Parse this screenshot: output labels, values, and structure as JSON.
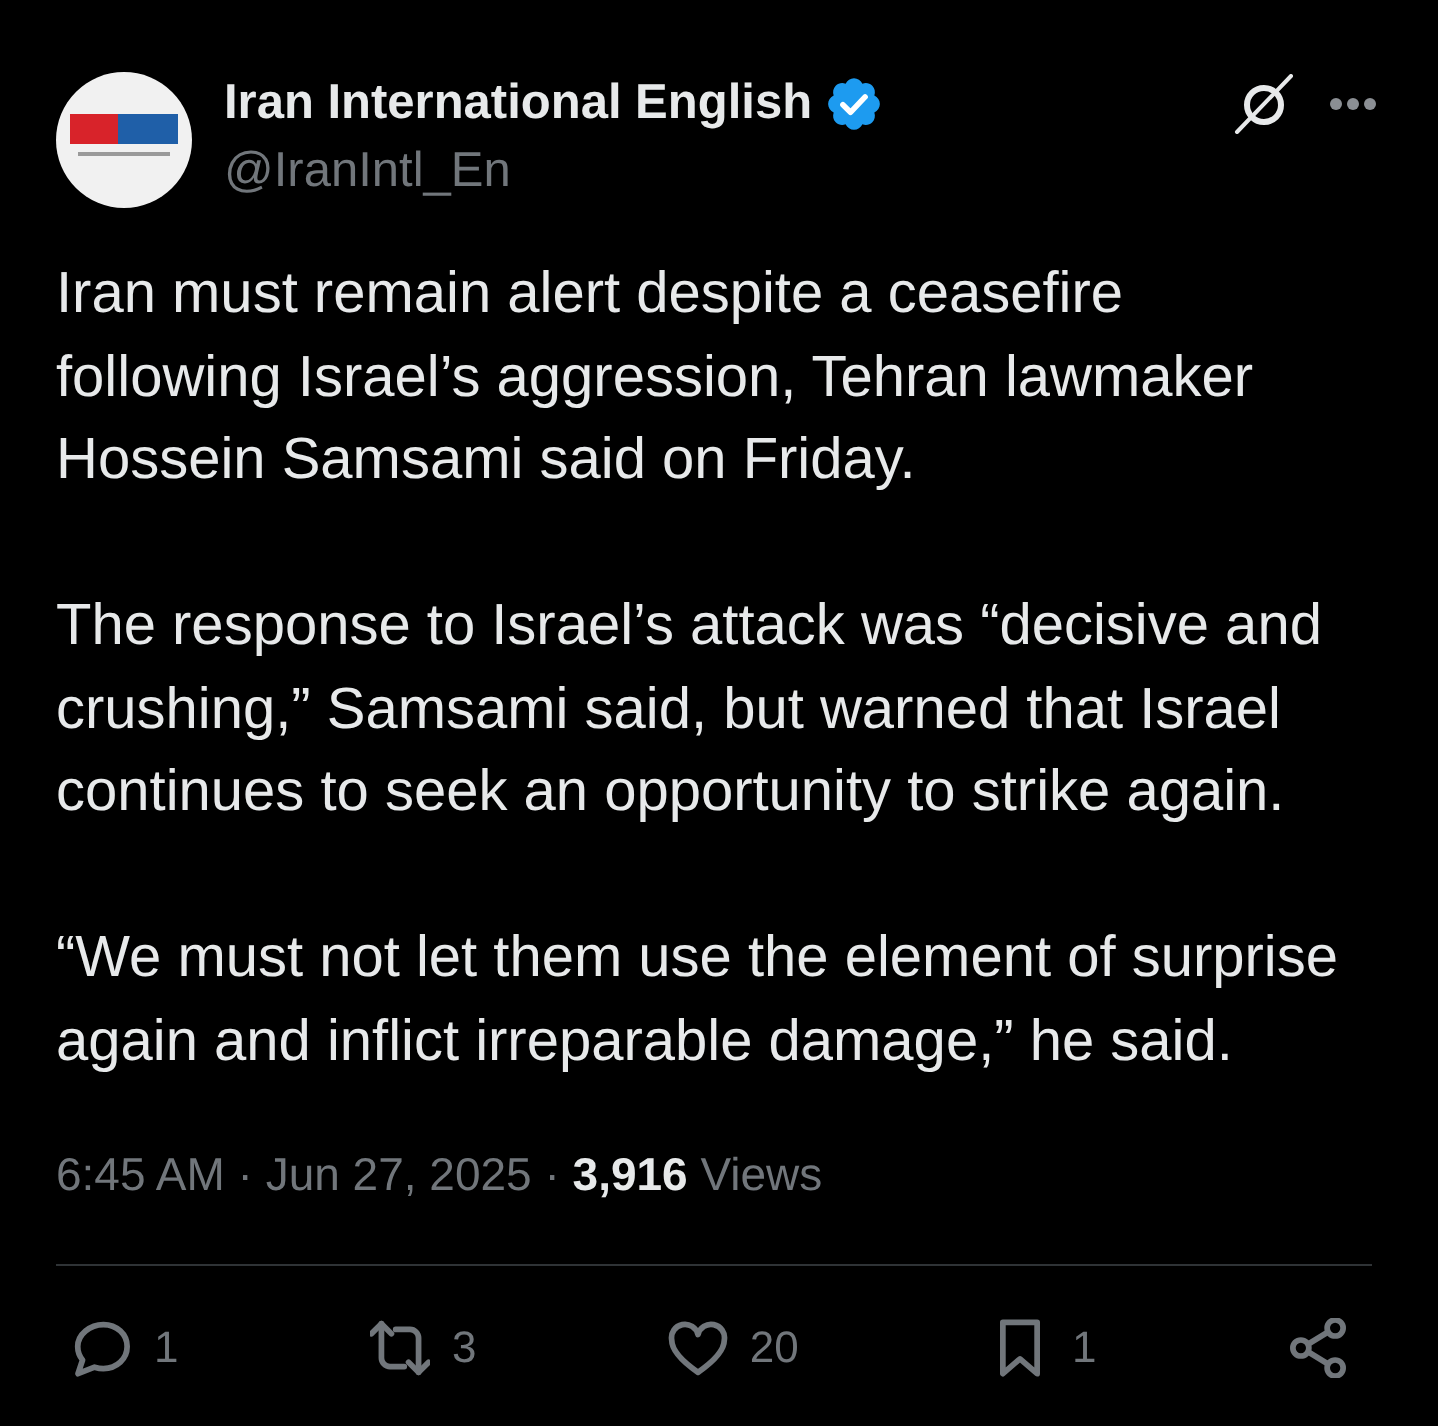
{
  "author": {
    "name": "Iran International English",
    "verified": true,
    "handle": "@IranIntl_En"
  },
  "post": {
    "paragraphs": [
      "Iran must remain alert despite a ceasefire following Israel’s aggression, Tehran lawmaker Hossein Samsami said on Friday.",
      "The response to Israel’s attack was “decisive and crushing,” Samsami said, but warned that Israel continues to seek an opportunity to strike again.",
      "“We must not let them use the element of surprise again and inflict irreparable damage,” he said."
    ],
    "meta": "6:45 AM · Jun 27, 2025 · **3,916** Views"
  },
  "actions": [
    {
      "kind": "reply",
      "count": "1"
    },
    {
      "kind": "repost",
      "count": "3"
    },
    {
      "kind": "like",
      "count": "20"
    },
    {
      "kind": "bookmark",
      "count": "1"
    },
    {
      "kind": "share"
    }
  ]
}
